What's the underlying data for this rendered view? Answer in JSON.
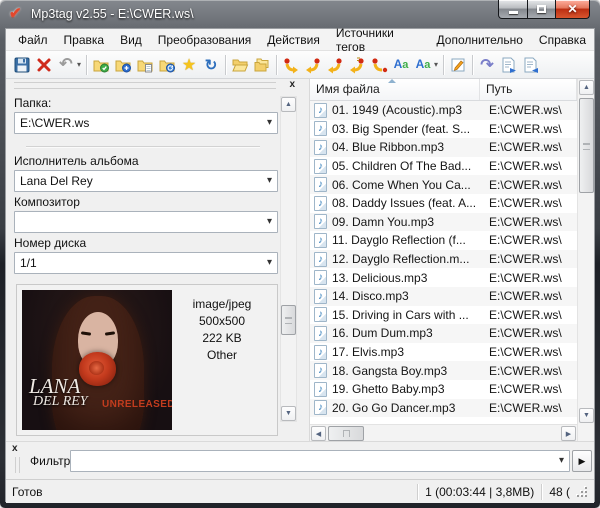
{
  "window": {
    "title": "Mp3tag v2.55  -  E:\\CWER.ws\\",
    "app_icon": "mp3tag-checkmark",
    "controls": [
      "minimize",
      "maximize",
      "close"
    ]
  },
  "menu": {
    "items": [
      "Файл",
      "Правка",
      "Вид",
      "Преобразования",
      "Действия",
      "Источники тегов",
      "Дополнительно",
      "Справка"
    ]
  },
  "toolbar": {
    "icons": [
      "save-tag",
      "remove-tag",
      "undo",
      "undo-dropdown",
      "folder-select",
      "folder-add",
      "folder-playlist",
      "folder-history",
      "favorites-star",
      "refresh",
      "open-folder",
      "duplicate-folder",
      "convert-tag-filename",
      "convert-filename-tag",
      "convert-filename-filename",
      "convert-textfile-tag",
      "convert-tag-tag",
      "case-conversion",
      "case-conversion-menu",
      "edit-tag",
      "actions",
      "export",
      "import"
    ]
  },
  "tag_panel": {
    "close": "x",
    "fields": [
      {
        "label": "Папка:",
        "value": "E:\\CWER.ws"
      },
      {
        "label": "Исполнитель альбома",
        "value": "Lana Del Rey"
      },
      {
        "label": "Композитор",
        "value": ""
      },
      {
        "label": "Номер диска",
        "value": "1/1"
      }
    ],
    "cover": {
      "art_line1": "LANA",
      "art_line2": "DEL REY",
      "art_badge": "UNRELEASED",
      "info": [
        "image/jpeg",
        "500x500",
        "222 KB",
        "Other"
      ]
    }
  },
  "file_list": {
    "columns": [
      "Имя файла",
      "Путь"
    ],
    "rows": [
      {
        "name": "01. 1949 (Acoustic).mp3",
        "path": "E:\\CWER.ws\\"
      },
      {
        "name": "03. Big Spender (feat. S...",
        "path": "E:\\CWER.ws\\"
      },
      {
        "name": "04. Blue Ribbon.mp3",
        "path": "E:\\CWER.ws\\"
      },
      {
        "name": "05. Children Of The Bad...",
        "path": "E:\\CWER.ws\\"
      },
      {
        "name": "06. Come When You Ca...",
        "path": "E:\\CWER.ws\\"
      },
      {
        "name": "08. Daddy Issues (feat. A...",
        "path": "E:\\CWER.ws\\"
      },
      {
        "name": "09. Damn You.mp3",
        "path": "E:\\CWER.ws\\"
      },
      {
        "name": "11. Dayglo Reflection (f...",
        "path": "E:\\CWER.ws\\"
      },
      {
        "name": "12. Dayglo Reflection.m...",
        "path": "E:\\CWER.ws\\"
      },
      {
        "name": "13. Delicious.mp3",
        "path": "E:\\CWER.ws\\"
      },
      {
        "name": "14. Disco.mp3",
        "path": "E:\\CWER.ws\\"
      },
      {
        "name": "15. Driving in Cars with ...",
        "path": "E:\\CWER.ws\\"
      },
      {
        "name": "16. Dum Dum.mp3",
        "path": "E:\\CWER.ws\\"
      },
      {
        "name": "17. Elvis.mp3",
        "path": "E:\\CWER.ws\\"
      },
      {
        "name": "18. Gangsta Boy.mp3",
        "path": "E:\\CWER.ws\\"
      },
      {
        "name": "19. Ghetto Baby.mp3",
        "path": "E:\\CWER.ws\\"
      },
      {
        "name": "20. Go Go Dancer.mp3",
        "path": "E:\\CWER.ws\\"
      }
    ]
  },
  "filter": {
    "close": "x",
    "label": "Фильтр",
    "value": "",
    "run_button": "▶"
  },
  "status": {
    "ready": "Готов",
    "selection": "1 (00:03:44 | 3,8MB)",
    "count": "48 ("
  },
  "colors": {
    "close_button": "#c13018",
    "note_icon": "#2a78b8",
    "unreleased_text": "#c23c1e",
    "folder_icon": "#f7d878"
  }
}
